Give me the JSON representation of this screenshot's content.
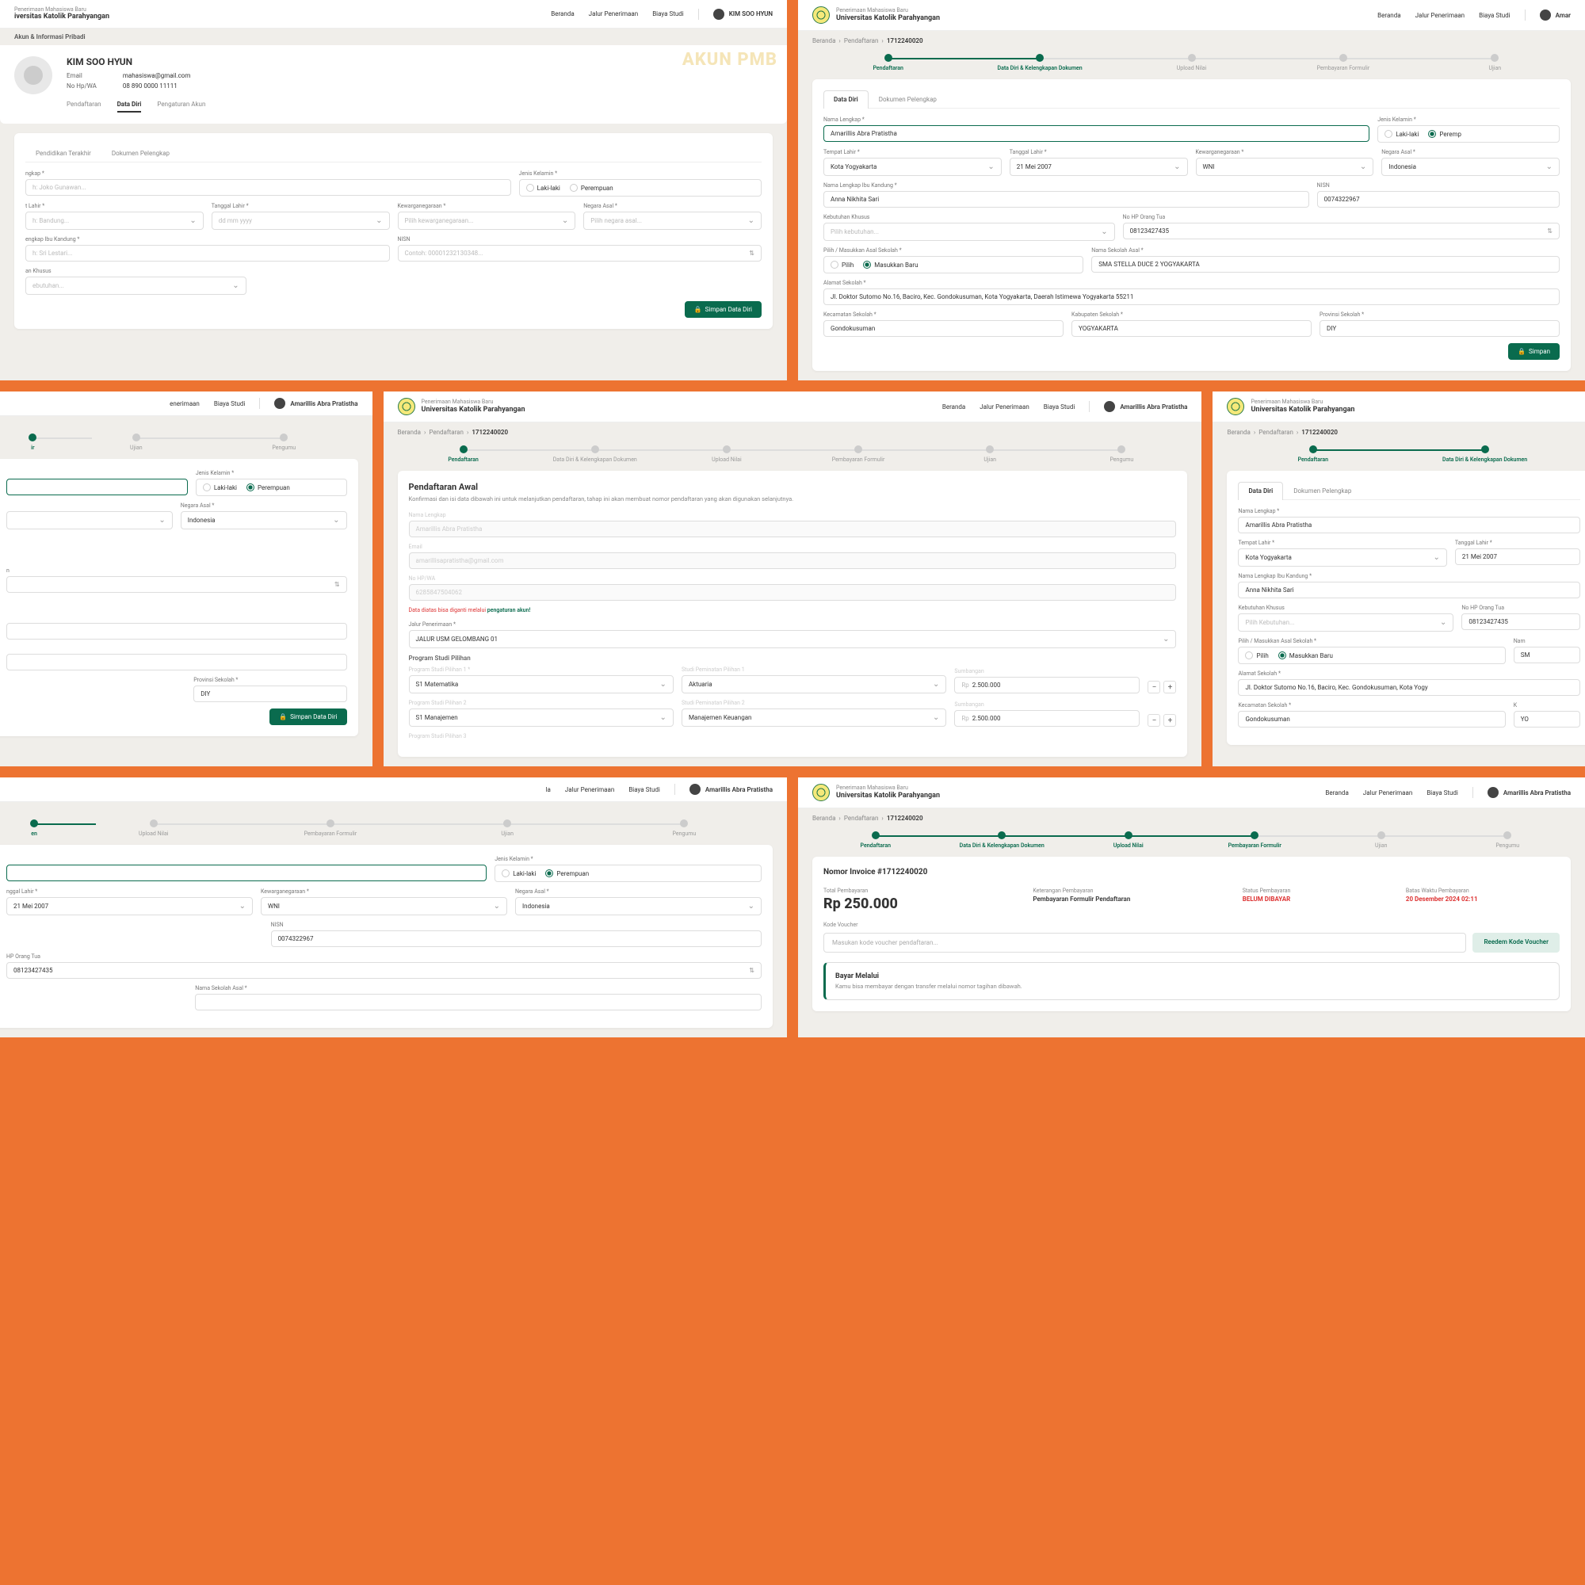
{
  "brand": {
    "sub": "Penerimaan Mahasiswa Baru",
    "main": "Universitas Katolik Parahyangan"
  },
  "nav": {
    "beranda": "Beranda",
    "jalur": "Jalur Penerimaan",
    "biaya": "Biaya Studi"
  },
  "users": {
    "kim": "KIM SOO HYUN",
    "amar": "Amarillis Abra Pratistha",
    "amar_short": "Amar"
  },
  "crumbs": {
    "pendaftaran": "Pendaftaran",
    "id": "1712240020"
  },
  "steps": {
    "s1": "Pendaftaran",
    "s2": "Data Diri & Kelengkapan Dokumen",
    "s3": "Upload Nilai",
    "s4": "Pembayaran Formulir",
    "s5": "Ujian",
    "s6": "Pengumu"
  },
  "tabs": {
    "dd": "Data Diri",
    "dp": "Dokumen Pelengkap",
    "pt": "Pendidikan Terakhir"
  },
  "s1": {
    "subhead": "Akun & Informasi Pribadi",
    "watermark": "AKUN PMB",
    "name": "KIM SOO HYUN",
    "email_l": "Email",
    "email_v": "mahasiswa@gmail.com",
    "hp_l": "No Hp/WA",
    "hp_v": "08 890 0000 11111",
    "ptabs": {
      "p": "Pendaftaran",
      "d": "Data Diri",
      "a": "Pengaturan Akun"
    },
    "f": {
      "nama": "ngkap *",
      "nama_ph": "h: Joko Gunawan...",
      "jk": "Jenis Kelamin *",
      "lk": "Laki-laki",
      "pr": "Perempuan",
      "tl": "t Lahir *",
      "tl_ph": "h: Bandung...",
      "tgl": "Tanggal Lahir *",
      "tgl_ph": "dd mm yyyy",
      "kw": "Kewarganegaraan *",
      "kw_ph": "Pilih kewarganegaraan...",
      "na": "Negara Asal *",
      "na_ph": "Pilih negara asal...",
      "ibu": "engkap Ibu Kandung *",
      "ibu_ph": "h: Sri Lestari...",
      "nisn": "NISN",
      "nisn_ph": "Contoh: 00001232130348...",
      "kk": "an Khusus",
      "kk_ph": "ebutuhan..."
    },
    "btn": "Simpan Data Diri"
  },
  "s2": {
    "f": {
      "nama": "Nama Lengkap *",
      "nama_v": "Amarillis Abra Pratistha",
      "jk": "Jenis Kelamin *",
      "lk": "Laki-laki",
      "pr": "Peremp",
      "tl": "Tempat Lahir *",
      "tl_v": "Kota Yogyakarta",
      "tgl": "Tanggal Lahir *",
      "tgl_v": "21 Mei 2007",
      "kw": "Kewarganegaraan *",
      "kw_v": "WNI",
      "na": "Negara Asal *",
      "na_v": "Indonesia",
      "ibu": "Nama Lengkap Ibu Kandung *",
      "ibu_v": "Anna Nikhita Sari",
      "nisn": "NISN",
      "nisn_v": "0074322967",
      "kk": "Kebutuhan Khusus",
      "kk_v": "Pilih kebutuhan...",
      "hp": "No HP Orang Tua",
      "hp_v": "08123427435",
      "as": "Pilih / Masukkan Asal Sekolah *",
      "pilih": "Pilih",
      "baru": "Masukkan Baru",
      "ns": "Nama Sekolah Asal *",
      "ns_v": "SMA STELLA DUCE 2 YOGYAKARTA",
      "al": "Alamat Sekolah *",
      "al_v": "Jl. Doktor Sutomo No.16, Baciro, Kec. Gondokusuman, Kota Yogyakarta, Daerah Istimewa Yogyakarta 55211",
      "kec": "Kecamatan Sekolah *",
      "kec_v": "Gondokusuman",
      "kab": "Kabupaten Sekolah *",
      "kab_v": "YOGYAKARTA",
      "prov": "Provinsi Sekolah *",
      "prov_v": "DIY"
    },
    "btn": "Simpan"
  },
  "s3": {
    "jk": "Jenis Kelamin *",
    "lk": "Laki-laki",
    "pr": "Perempuan",
    "na": "Negara Asal *",
    "na_v": "Indonesia",
    "prov": "Provinsi Sekolah *",
    "prov_v": "DIY",
    "btn": "Simpan Data Diri"
  },
  "s5": {
    "title": "Pendaftaran Awal",
    "desc": "Konfirmasi dan isi data dibawah ini untuk melanjutkan pendaftaran, tahap ini akan membuat nomor pendaftaran yang akan digunakan selanjutnya.",
    "nama_l": "Nama Lengkap",
    "nama_v": "Amarillis Abra Pratistha",
    "email_l": "Email",
    "email_v": "amarillisapratistha@gmail.com",
    "hp_l": "No HP/WA",
    "hp_v": "6285847504062",
    "note": "Data diatas bisa diganti melalui ",
    "note_link": "pengaturan akun!",
    "jalur_l": "Jalur Penerimaan *",
    "jalur_v": "JALUR USM GELOMBANG 01",
    "sect": "Program Studi Pilihan",
    "cols": {
      "ps": "Program Studi Pilihan",
      "sp": "Studi Peminatan Pilihan",
      "sb": "Sumbangan"
    },
    "r1": {
      "ps": "S1 Matematika",
      "sp": "Aktuaria",
      "sb": "2.500.000"
    },
    "r2": {
      "ps": "S1 Manajemen",
      "sp": "Manajemen Keuangan",
      "sb": "2.500.000"
    },
    "r3": {
      "ps": "Program Studi Pilihan 3"
    },
    "rp": "Rp"
  },
  "s6": {
    "f": {
      "nama": "Nama Lengkap *",
      "nama_v": "Amarillis Abra Pratistha",
      "tl": "Tempat Lahir *",
      "tl_v": "Kota Yogyakarta",
      "tgl": "Tanggal Lahir *",
      "tgl_v": "21 Mei 2007",
      "ibu": "Nama Lengkap Ibu Kandung *",
      "ibu_v": "Anna Nikhita Sari",
      "kk": "Kebutuhan Khusus",
      "kk_v": "Pilih Kebutuhan...",
      "hp": "No HP Orang Tua",
      "hp_v": "08123427435",
      "as": "Pilih / Masukkan Asal Sekolah *",
      "pilih": "Pilih",
      "baru": "Masukkan Baru",
      "nm": "Nam",
      "nm_v": "SM",
      "al": "Alamat Sekolah *",
      "al_v": "Jl. Doktor Sutomo No.16, Baciro, Kec. Gondokusuman, Kota Yogy",
      "kec": "Kecamatan Sekolah *",
      "kec_v": "Gondokusuman",
      "kab": "K",
      "kab_v": "YO"
    }
  },
  "s7": {
    "steps": {
      "un": "Upload Nilai",
      "pf": "Pembayaran Formulir",
      "uj": "Ujian",
      "pg": "Pengumu"
    },
    "jk": "Jenis Kelamin *",
    "lk": "Laki-laki",
    "pr": "Perempuan",
    "tgl": "nggal Lahir *",
    "tgl_v": "21 Mei 2007",
    "kw": "Kewarganegaraan *",
    "kw_v": "WNI",
    "na": "Negara Asal *",
    "na_v": "Indonesia",
    "nisn": "NISN",
    "nisn_v": "0074322967",
    "hp": "HP Orang Tua",
    "hp_v": "08123427435",
    "ns": "Nama Sekolah Asal *"
  },
  "s8": {
    "invoice": "Nomor Invoice #1712240020",
    "tp_l": "Total Pembayaran",
    "tp_v": "Rp 250.000",
    "kp_l": "Keterangan Pembayaran",
    "kp_v": "Pembayaran Formulir Pendaftaran",
    "sp_l": "Status Pembayaran",
    "sp_v": "BELUM DIBAYAR",
    "bw_l": "Batas Waktu Pembayaran",
    "bw_v": "20 Desember 2024 02:11",
    "kv_l": "Kode Voucher",
    "kv_ph": "Masukan kode voucher pendaftaran...",
    "kv_btn": "Reedem Kode Voucher",
    "bm_t": "Bayar Melalui",
    "bm_d": "Kamu bisa membayar dengan transfer melalui nomor tagihan dibawah."
  }
}
